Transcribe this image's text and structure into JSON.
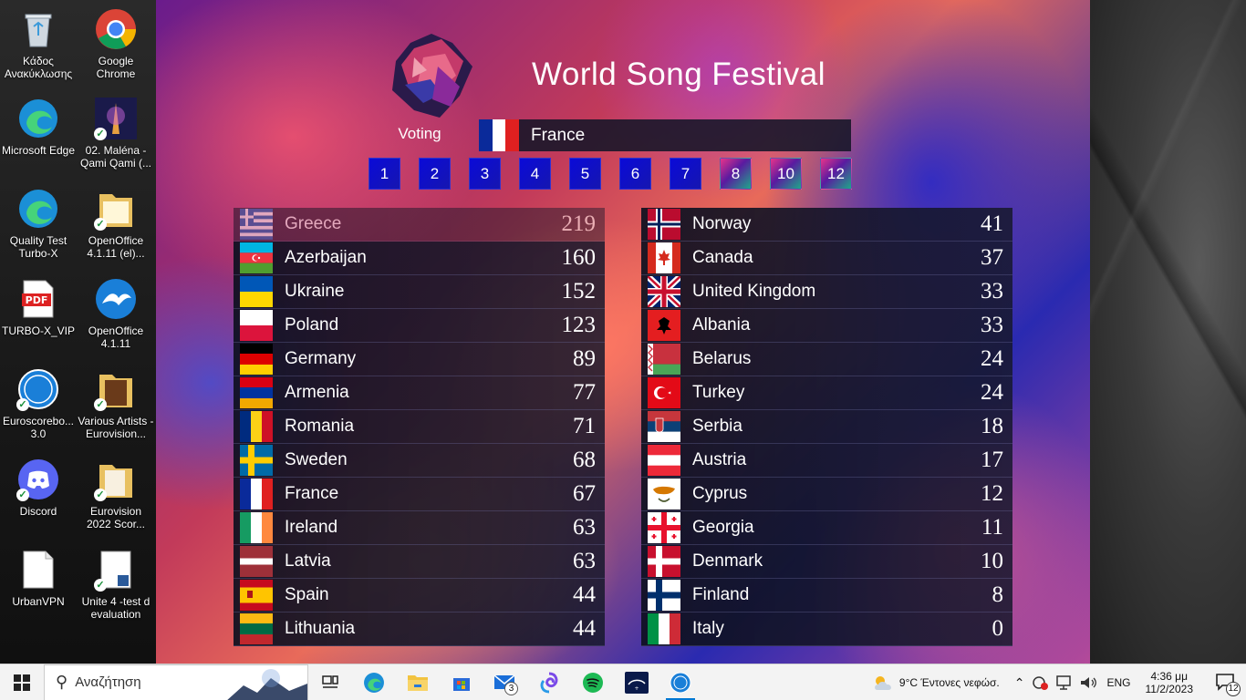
{
  "desktop": {
    "icons_left": [
      {
        "name": "recycle-bin-icon",
        "label": "Κάδος Ανακύκλωσης"
      },
      {
        "name": "microsoft-edge-icon",
        "label": "Microsoft Edge"
      },
      {
        "name": "quality-test-icon",
        "label": "Quality Test Turbo-X"
      },
      {
        "name": "pdf-icon",
        "label": "TURBO-X_VIP"
      },
      {
        "name": "euroscoreboard-icon",
        "label": "Euroscorebo... 3.0"
      },
      {
        "name": "discord-icon",
        "label": "Discord"
      },
      {
        "name": "urbanvpn-icon",
        "label": "UrbanVPN"
      }
    ],
    "icons_right": [
      {
        "name": "google-chrome-icon",
        "label": "Google Chrome"
      },
      {
        "name": "video-file-icon",
        "label": "02. Maléna - Qami Qami (..."
      },
      {
        "name": "openoffice-folder-icon",
        "label": "OpenOffice 4.1.11 (el)..."
      },
      {
        "name": "openoffice-icon",
        "label": "OpenOffice 4.1.11"
      },
      {
        "name": "folder-icon",
        "label": "Various Artists - Eurovision..."
      },
      {
        "name": "folder-icon",
        "label": "Eurovision 2022 Scor..."
      },
      {
        "name": "document-icon",
        "label": "Unite 4 -test d evaluation"
      }
    ]
  },
  "app": {
    "title": "World Song Festival",
    "voting_label": "Voting",
    "current_country": "France",
    "points": [
      {
        "label": "1",
        "used": false
      },
      {
        "label": "2",
        "used": false
      },
      {
        "label": "3",
        "used": false
      },
      {
        "label": "4",
        "used": false
      },
      {
        "label": "5",
        "used": false
      },
      {
        "label": "6",
        "used": false
      },
      {
        "label": "7",
        "used": false
      },
      {
        "label": "8",
        "used": true
      },
      {
        "label": "10",
        "used": true
      },
      {
        "label": "12",
        "used": true
      }
    ],
    "left_board": [
      {
        "country": "Greece",
        "score": "219",
        "flag": "greece",
        "dim": true
      },
      {
        "country": "Azerbaijan",
        "score": "160",
        "flag": "azerbaijan"
      },
      {
        "country": "Ukraine",
        "score": "152",
        "flag": "ukraine"
      },
      {
        "country": "Poland",
        "score": "123",
        "flag": "poland"
      },
      {
        "country": "Germany",
        "score": "89",
        "flag": "germany"
      },
      {
        "country": "Armenia",
        "score": "77",
        "flag": "armenia"
      },
      {
        "country": "Romania",
        "score": "71",
        "flag": "romania"
      },
      {
        "country": "Sweden",
        "score": "68",
        "flag": "sweden"
      },
      {
        "country": "France",
        "score": "67",
        "flag": "france"
      },
      {
        "country": "Ireland",
        "score": "63",
        "flag": "ireland"
      },
      {
        "country": "Latvia",
        "score": "63",
        "flag": "latvia"
      },
      {
        "country": "Spain",
        "score": "44",
        "flag": "spain"
      },
      {
        "country": "Lithuania",
        "score": "44",
        "flag": "lithuania"
      }
    ],
    "right_board": [
      {
        "country": "Norway",
        "score": "41",
        "flag": "norway"
      },
      {
        "country": "Canada",
        "score": "37",
        "flag": "canada"
      },
      {
        "country": "United Kingdom",
        "score": "33",
        "flag": "uk"
      },
      {
        "country": "Albania",
        "score": "33",
        "flag": "albania"
      },
      {
        "country": "Belarus",
        "score": "24",
        "flag": "belarus"
      },
      {
        "country": "Turkey",
        "score": "24",
        "flag": "turkey"
      },
      {
        "country": "Serbia",
        "score": "18",
        "flag": "serbia"
      },
      {
        "country": "Austria",
        "score": "17",
        "flag": "austria"
      },
      {
        "country": "Cyprus",
        "score": "12",
        "flag": "cyprus"
      },
      {
        "country": "Georgia",
        "score": "11",
        "flag": "georgia"
      },
      {
        "country": "Denmark",
        "score": "10",
        "flag": "denmark"
      },
      {
        "country": "Finland",
        "score": "8",
        "flag": "finland"
      },
      {
        "country": "Italy",
        "score": "0",
        "flag": "italy"
      }
    ]
  },
  "taskbar": {
    "search_placeholder": "Αναζήτηση",
    "mail_badge": "3",
    "weather": "9°C  Έντονες νεφώσ.",
    "language": "ENG",
    "time": "4:36 μμ",
    "date": "11/2/2023",
    "notification_count": "12"
  },
  "colors": {
    "point_button": "#0a0ad8",
    "taskbar_bg": "#f3f3f3",
    "accent": "#0078d4"
  }
}
